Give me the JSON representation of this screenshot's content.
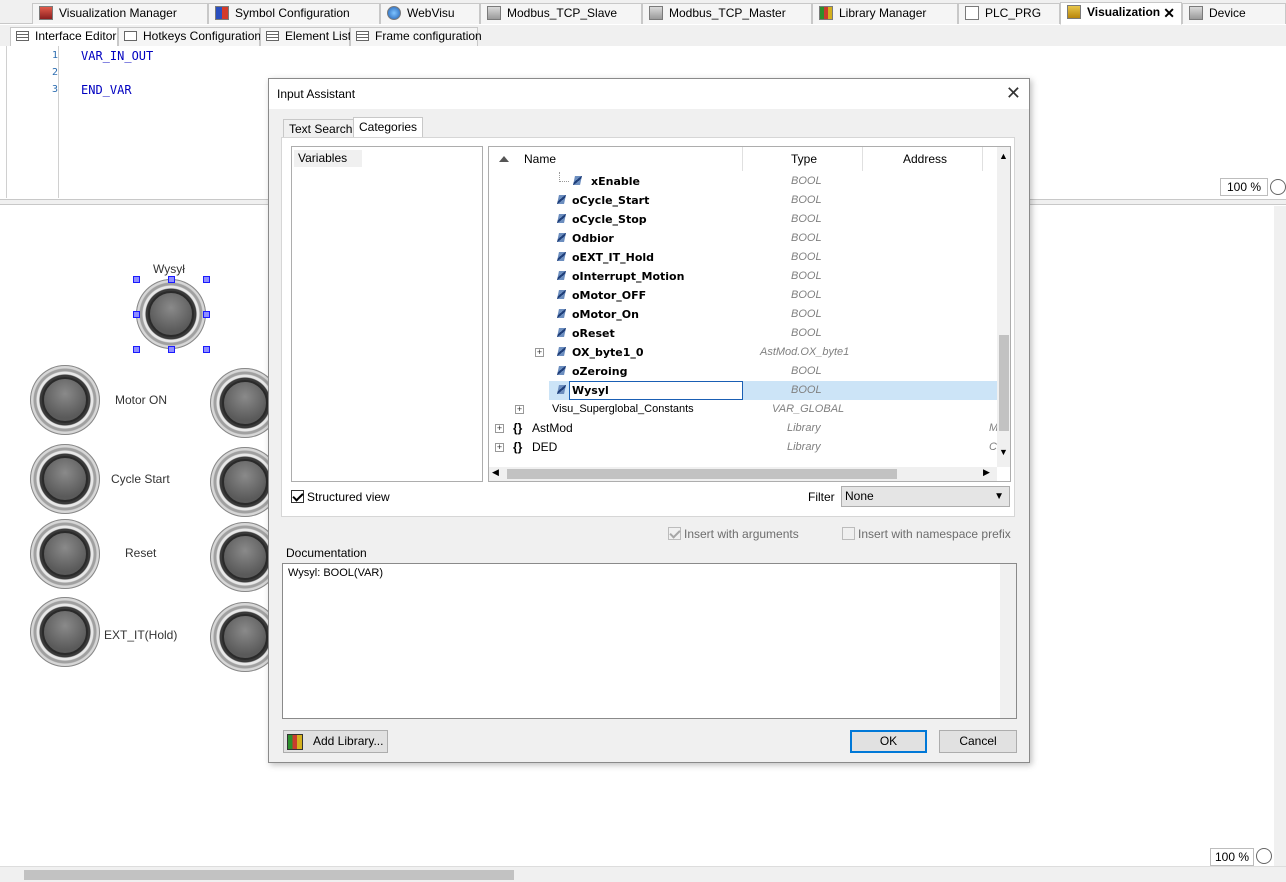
{
  "doc_tabs": [
    {
      "label": "Visualization Manager"
    },
    {
      "label": "Symbol Configuration"
    },
    {
      "label": "WebVisu"
    },
    {
      "label": "Modbus_TCP_Slave"
    },
    {
      "label": "Modbus_TCP_Master"
    },
    {
      "label": "Library Manager"
    },
    {
      "label": "PLC_PRG"
    },
    {
      "label": "Visualization"
    },
    {
      "label": "Device"
    }
  ],
  "sub_tabs": [
    {
      "label": "Interface Editor"
    },
    {
      "label": "Hotkeys Configuration"
    },
    {
      "label": "Element List"
    },
    {
      "label": "Frame configuration"
    }
  ],
  "code": {
    "lines": [
      {
        "num": "1",
        "text": "VAR_IN_OUT"
      },
      {
        "num": "2",
        "text": ""
      },
      {
        "num": "3",
        "text": "END_VAR"
      }
    ]
  },
  "zoom_top": "100 %",
  "zoom_bottom": "100 %",
  "canvas": {
    "selected_label": "Wysył",
    "labels": [
      "Motor ON",
      "Cycle Start",
      "Reset",
      "EXT_IT(Hold)"
    ]
  },
  "dialog": {
    "title": "Input Assistant",
    "close_glyph": "✕",
    "tabs": [
      "Text Search",
      "Categories"
    ],
    "category_item": "Variables",
    "tree_headers": {
      "name": "Name",
      "type": "Type",
      "address": "Address"
    },
    "rows": [
      {
        "name": "xEnable",
        "type": "BOOL",
        "address": ""
      },
      {
        "name": "oCycle_Start",
        "type": "BOOL",
        "address": ""
      },
      {
        "name": "oCycle_Stop",
        "type": "BOOL",
        "address": ""
      },
      {
        "name": "Odbior",
        "type": "BOOL",
        "address": ""
      },
      {
        "name": "oEXT_IT_Hold",
        "type": "BOOL",
        "address": ""
      },
      {
        "name": "oInterrupt_Motion",
        "type": "BOOL",
        "address": ""
      },
      {
        "name": "oMotor_OFF",
        "type": "BOOL",
        "address": ""
      },
      {
        "name": "oMotor_On",
        "type": "BOOL",
        "address": ""
      },
      {
        "name": "oReset",
        "type": "BOOL",
        "address": ""
      },
      {
        "name": "OX_byte1_0",
        "type": "AstMod.OX_byte1",
        "address": ""
      },
      {
        "name": "oZeroing",
        "type": "BOOL",
        "address": ""
      },
      {
        "name": "Wysyl",
        "type": "BOOL",
        "address": ""
      },
      {
        "name": "Visu_Superglobal_Constants",
        "type": "VAR_GLOBAL",
        "address": ""
      },
      {
        "name": "AstMod",
        "type": "Library",
        "address": "M"
      },
      {
        "name": "DED",
        "type": "Library",
        "address": "C."
      }
    ],
    "structured_view_label": "Structured view",
    "filter_label": "Filter",
    "filter_value": "None",
    "insert_with_arguments": "Insert with arguments",
    "insert_with_namespace": "Insert with namespace prefix",
    "documentation_label": "Documentation",
    "documentation_text": "Wysyl: BOOL(VAR)",
    "add_library": "Add Library...",
    "ok": "OK",
    "cancel": "Cancel"
  },
  "colors": {
    "accent": "#0078d7",
    "selection": "#cce4f7",
    "code_keyword": "#0000c0"
  }
}
